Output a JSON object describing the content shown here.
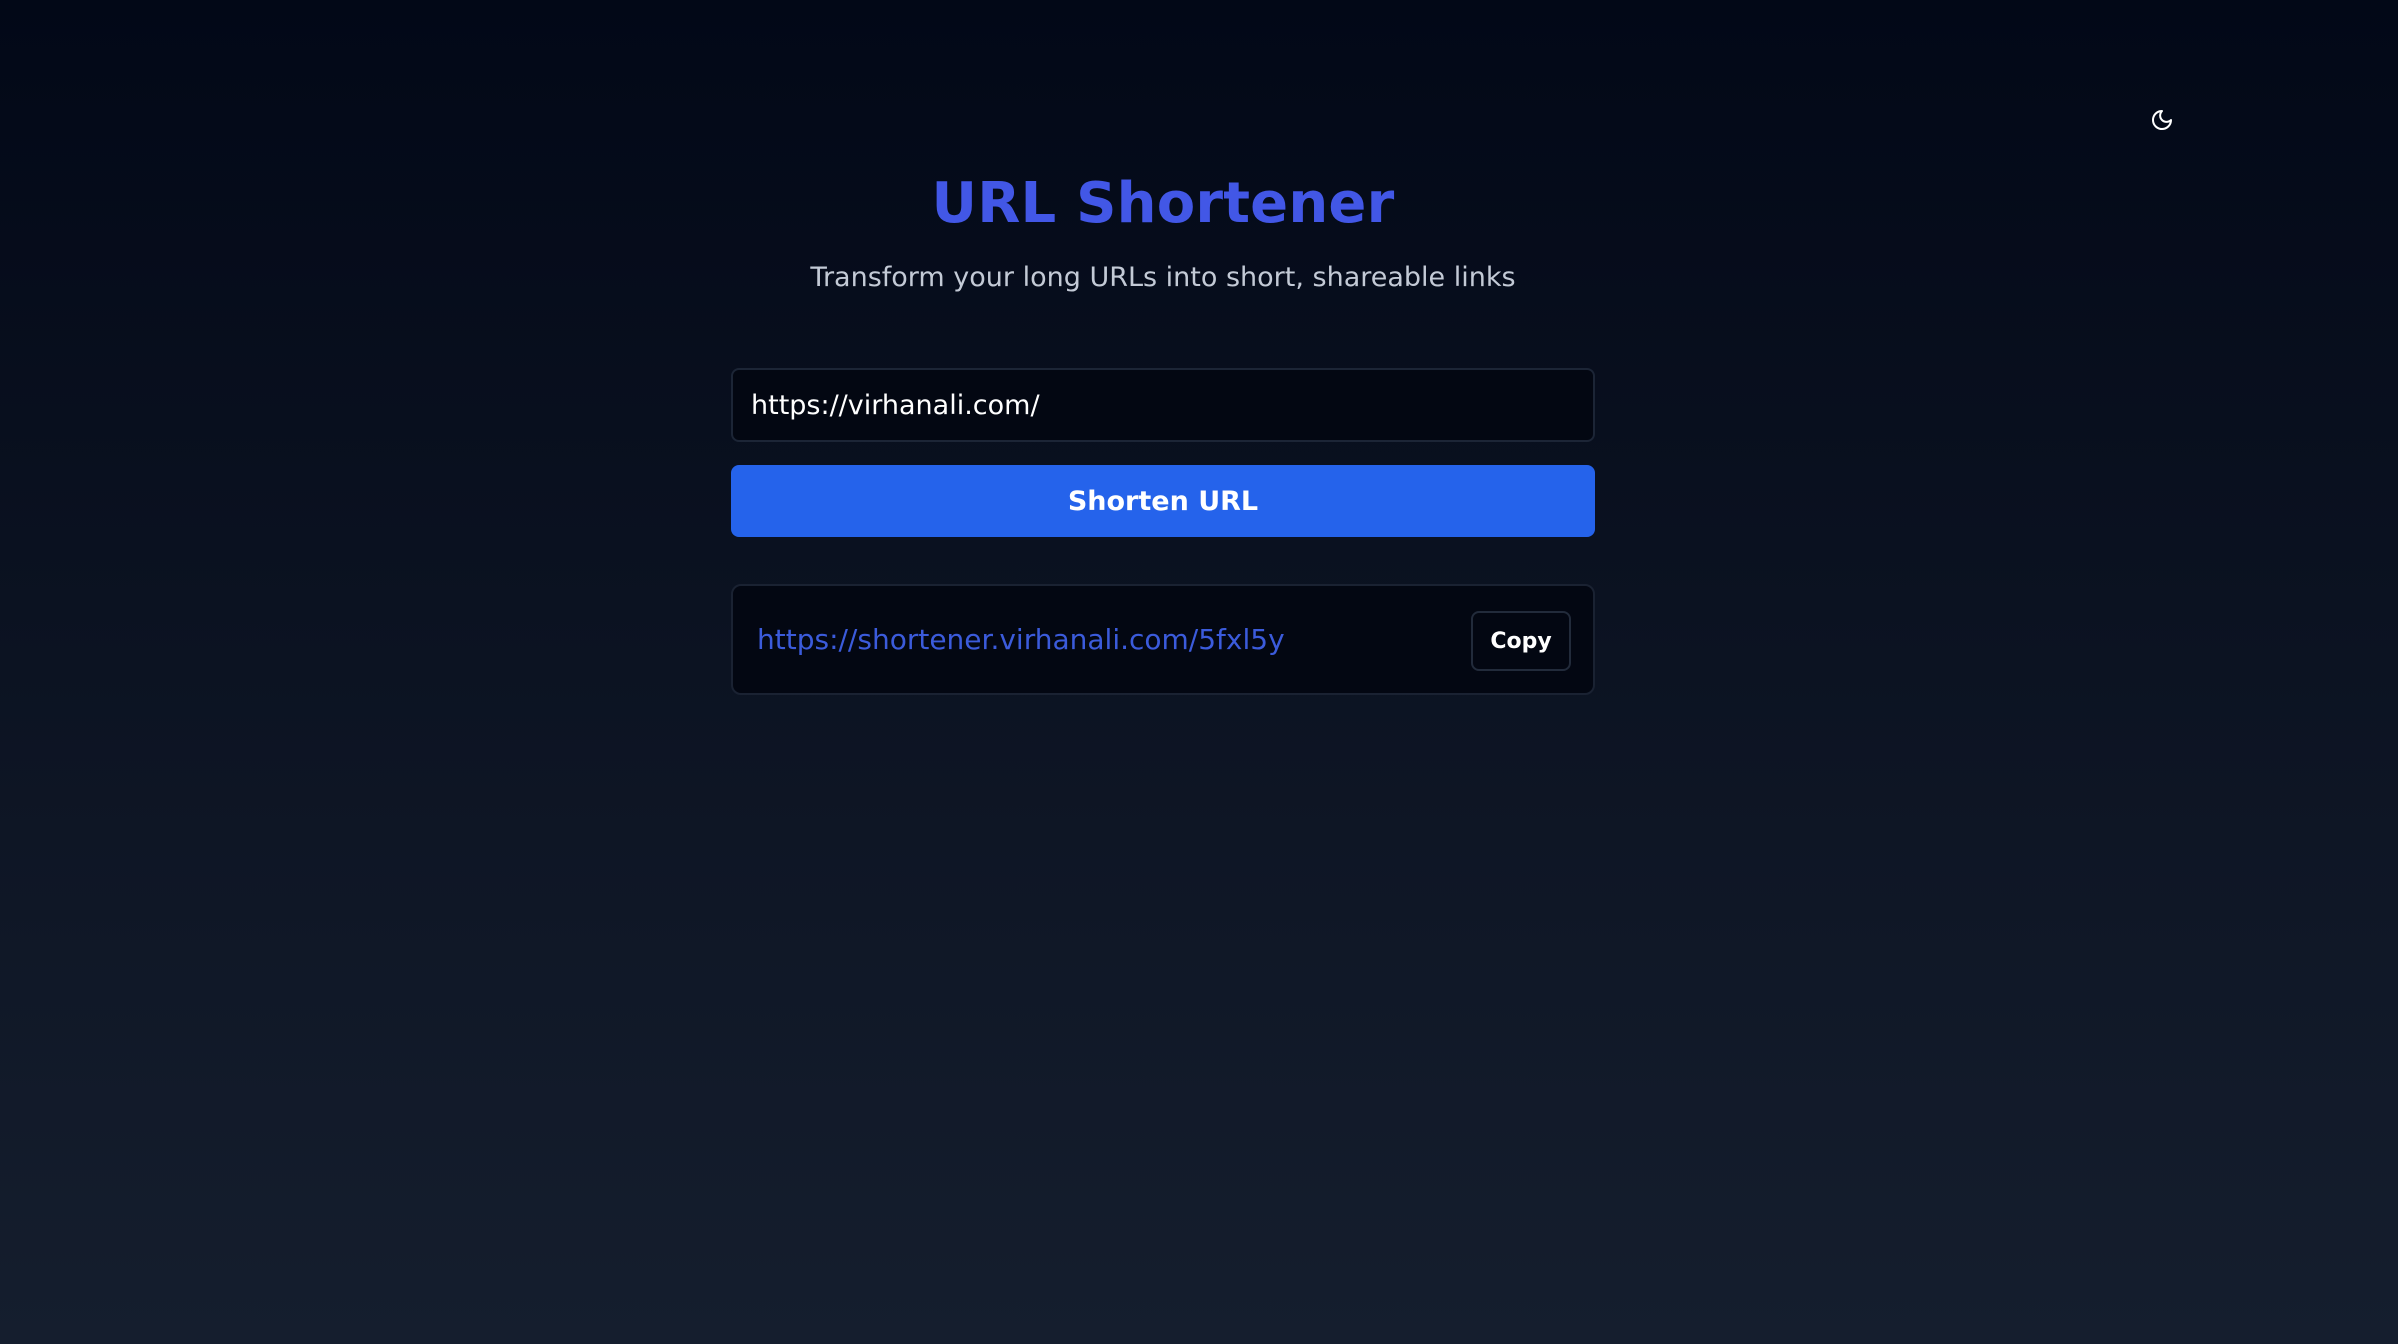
{
  "header": {
    "theme_toggle_icon": "moon-icon"
  },
  "main": {
    "title": "URL Shortener",
    "subtitle": "Transform your long URLs into short, shareable links",
    "url_input": {
      "value": "https://virhanali.com/",
      "placeholder": ""
    },
    "shorten_button_label": "Shorten URL",
    "result": {
      "short_url": "https://shortener.virhanali.com/5fxl5y",
      "copy_button_label": "Copy"
    }
  },
  "colors": {
    "accent": "#2563eb",
    "title": "#4257e6",
    "link": "#3b5bdb",
    "background_top": "#020817",
    "background_bottom": "#151e2e"
  }
}
